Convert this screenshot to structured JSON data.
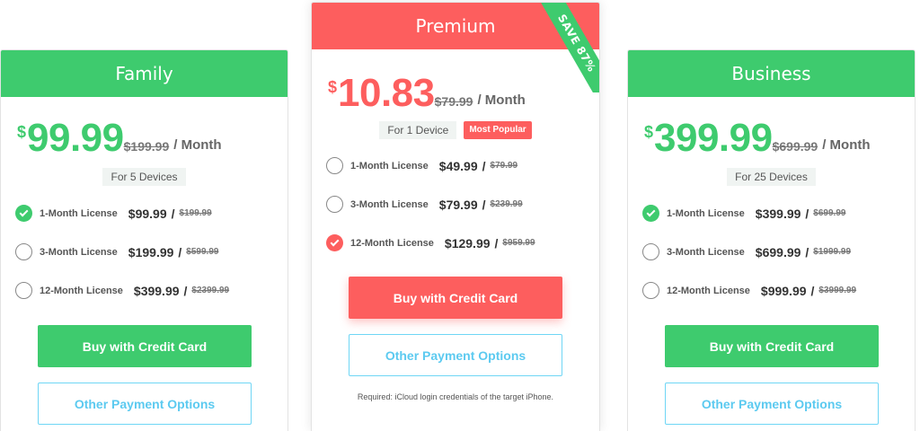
{
  "plans": {
    "family": {
      "title": "Family",
      "currency": "$",
      "price": "99.99",
      "old_price": "$199.99",
      "period": "/ Month",
      "devices": "For 5 Devices",
      "options": [
        {
          "label": "1-Month License",
          "price": "$99.99",
          "old": "$199.99",
          "selected": true
        },
        {
          "label": "3-Month License",
          "price": "$199.99",
          "old": "$599.99",
          "selected": false
        },
        {
          "label": "12-Month License",
          "price": "$399.99",
          "old": "$2399.99",
          "selected": false
        }
      ],
      "buy_label": "Buy with Credit Card",
      "other_label": "Other Payment Options"
    },
    "premium": {
      "title": "Premium",
      "ribbon": "SAVE 87%",
      "currency": "$",
      "price": "10.83",
      "old_price": "$79.99",
      "period": "/ Month",
      "devices": "For 1 Device",
      "badge": "Most Popular",
      "options": [
        {
          "label": "1-Month License",
          "price": "$49.99",
          "old": "$79.99",
          "selected": false
        },
        {
          "label": "3-Month License",
          "price": "$79.99",
          "old": "$239.99",
          "selected": false
        },
        {
          "label": "12-Month License",
          "price": "$129.99",
          "old": "$959.99",
          "selected": true
        }
      ],
      "buy_label": "Buy with Credit Card",
      "other_label": "Other Payment Options",
      "note": "Required: iCloud login credentials of the target iPhone."
    },
    "business": {
      "title": "Business",
      "currency": "$",
      "price": "399.99",
      "old_price": "$699.99",
      "period": "/ Month",
      "devices": "For 25 Devices",
      "options": [
        {
          "label": "1-Month License",
          "price": "$399.99",
          "old": "$699.99",
          "selected": true
        },
        {
          "label": "3-Month License",
          "price": "$699.99",
          "old": "$1999.99",
          "selected": false
        },
        {
          "label": "12-Month License",
          "price": "$999.99",
          "old": "$3999.99",
          "selected": false
        }
      ],
      "buy_label": "Buy with Credit Card",
      "other_label": "Other Payment Options"
    }
  },
  "colors": {
    "green": "#3ecb6e",
    "red": "#fd5e5e",
    "outline_blue": "#5ccaf0"
  }
}
